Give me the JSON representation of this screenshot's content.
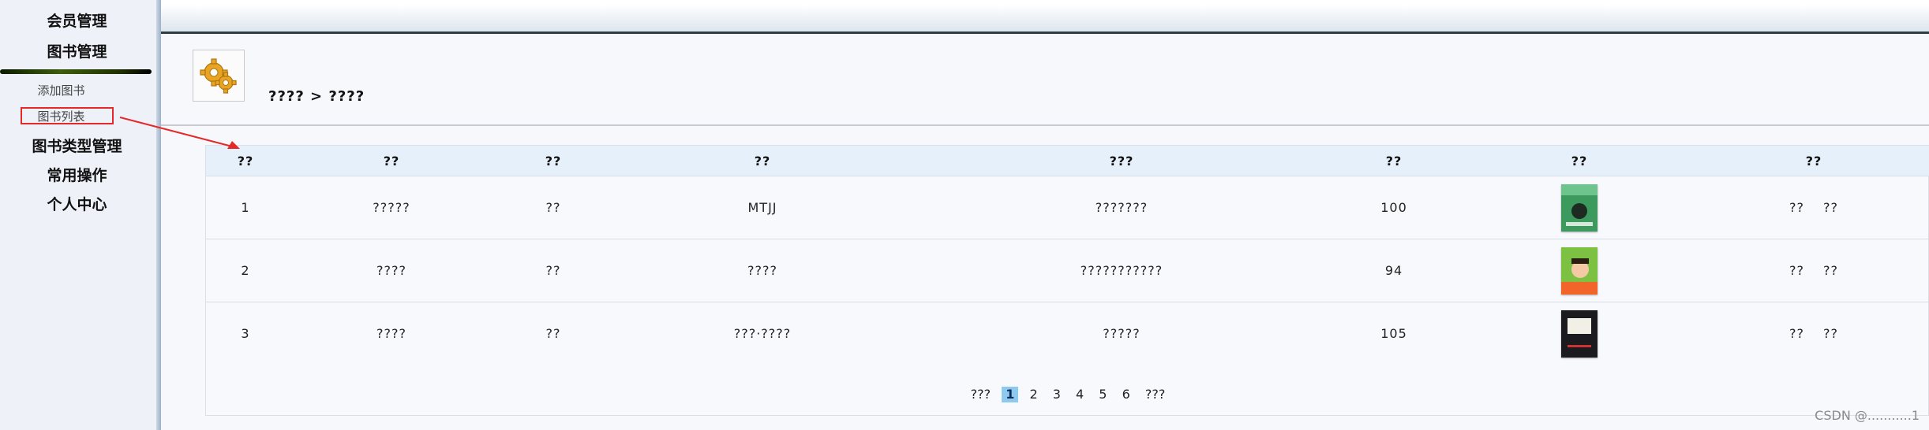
{
  "sidebar": {
    "member_mgmt": "会员管理",
    "book_mgmt": "图书管理",
    "sub_items": [
      "添加图书",
      "图书列表"
    ],
    "book_type_mgmt": "图书类型管理",
    "common_ops": "常用操作",
    "personal_center": "个人中心"
  },
  "breadcrumb": "???? > ????",
  "table": {
    "headers": [
      "??",
      "??",
      "??",
      "??",
      "???",
      "??",
      "??",
      "??"
    ],
    "rows": [
      {
        "no": "1",
        "name": "?????",
        "type": "??",
        "author": "MTJJ",
        "publisher": "???????",
        "count": "100",
        "op1": "??",
        "op2": "??"
      },
      {
        "no": "2",
        "name": "????",
        "type": "??",
        "author": "????",
        "publisher": "???????????",
        "count": "94",
        "op1": "??",
        "op2": "??"
      },
      {
        "no": "3",
        "name": "????",
        "type": "??",
        "author": "???·????",
        "publisher": "?????",
        "count": "105",
        "op1": "??",
        "op2": "??"
      }
    ]
  },
  "pager": {
    "prev": "???",
    "pages": [
      "1",
      "2",
      "3",
      "4",
      "5",
      "6"
    ],
    "next": "???"
  },
  "watermark": "CSDN @...........1",
  "colors": {
    "highlight": "#e52828",
    "header_row_bg": "#e6f0fb",
    "current_page_bg": "#8ec9f0"
  },
  "icons": [
    "gear-icon",
    "book-cover-image",
    "annotation-arrow"
  ]
}
